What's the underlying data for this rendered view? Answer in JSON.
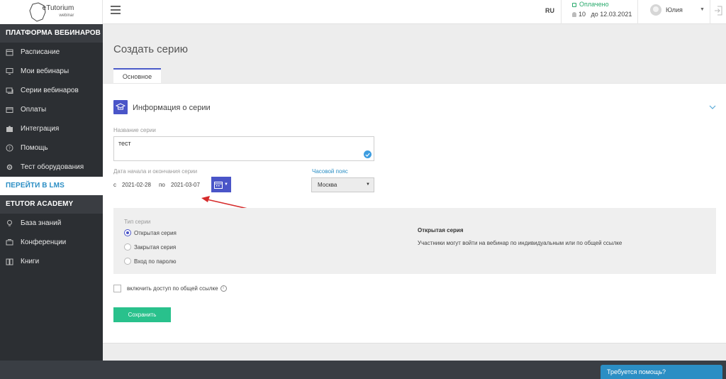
{
  "brand": {
    "name": "eTutorium",
    "sub": "webinar"
  },
  "sidebar": {
    "section_platform": "ПЛАТФОРМА ВЕБИНАРОВ",
    "items": [
      {
        "label": "Расписание",
        "icon": "calendar-icon"
      },
      {
        "label": "Мои вебинары",
        "icon": "monitor-icon"
      },
      {
        "label": "Серии вебинаров",
        "icon": "stack-icon"
      },
      {
        "label": "Оплаты",
        "icon": "wallet-icon"
      },
      {
        "label": "Интеграция",
        "icon": "puzzle-icon"
      },
      {
        "label": "Помощь",
        "icon": "help-icon"
      },
      {
        "label": "Тест оборудования",
        "icon": "gear-icon"
      }
    ],
    "lms_link": "ПЕРЕЙТИ В LMS",
    "section_academy": "ETUTOR ACADEMY",
    "academy_items": [
      {
        "label": "База знаний",
        "icon": "lightbulb-icon"
      },
      {
        "label": "Конференции",
        "icon": "conference-icon"
      },
      {
        "label": "Книги",
        "icon": "book-icon"
      }
    ]
  },
  "topbar": {
    "lang": "RU",
    "paid": "Оплачено",
    "seats": "10",
    "until": "до 12.03.2021",
    "user": "Юлия"
  },
  "page": {
    "title": "Создать серию",
    "tab": "Основное",
    "section_title": "Информация о серии",
    "name_label": "Название серии",
    "name_value": "тест",
    "dates_label": "Дата начала и окончания серии",
    "from_label": "с",
    "from_value": "2021-02-28",
    "to_label": "по",
    "to_value": "2021-03-07",
    "tz_label": "Часовой пояс",
    "tz_value": "Москва",
    "type_label": "Тип серии",
    "types": [
      "Открытая серия",
      "Закрытая серия",
      "Вход по паролю"
    ],
    "selected_type": "Открытая серия",
    "desc_title": "Открытая серия",
    "desc_text": "Участники могут войти на вебинар по индивидуальным или по общей ссылке",
    "shared_link_label": "включить доступ по общей ссылке",
    "save_label": "Сохранить"
  },
  "help": {
    "label": "Требуется помощь?"
  },
  "colors": {
    "accent": "#4a55c8",
    "success": "#29c18c",
    "link": "#2b8ec4",
    "sidebar": "#2c2f33"
  }
}
